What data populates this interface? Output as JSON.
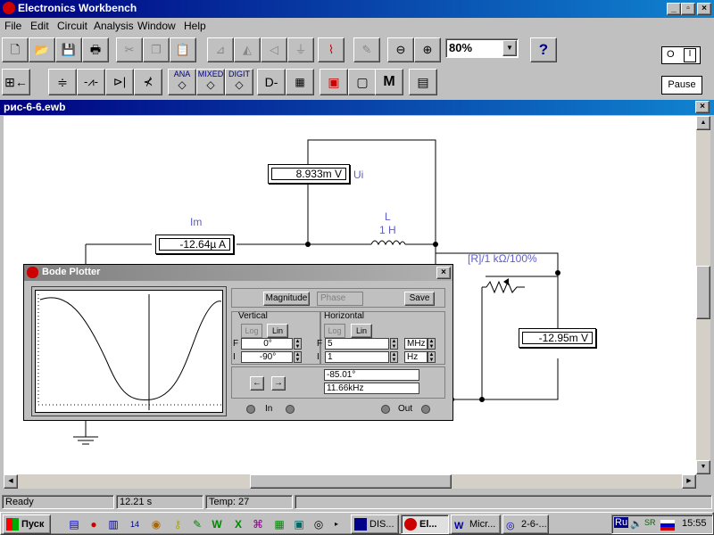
{
  "app": {
    "title": "Electronics Workbench"
  },
  "menu": [
    "File",
    "Edit",
    "Circuit",
    "Analysis",
    "Window",
    "Help"
  ],
  "toolbar": {
    "zoom_value": "80%",
    "help_label": "?",
    "pause_label": "Pause"
  },
  "parts_bin": {
    "analog_label": "ANA",
    "mixed_label": "MIXED",
    "digital_label": "DIGIT",
    "misc_label": "M"
  },
  "document": {
    "title": "рис-6-6.ewb"
  },
  "circuit": {
    "voltmeter_ui": {
      "value": "8.933m V",
      "label": "Ui"
    },
    "ammeter_im": {
      "value": "-12.64µ A",
      "label": "Im"
    },
    "inductor": {
      "label": "L",
      "value": "1 H"
    },
    "potentiometer": {
      "label": "[R]/1 kΩ/100%"
    },
    "voltmeter_out": {
      "value": "-12.95m V"
    }
  },
  "bode_plotter": {
    "title": "Bode Plotter",
    "magnitude_label": "Magnitude",
    "phase_label": "Phase",
    "save_label": "Save",
    "vertical": {
      "label": "Vertical",
      "log": "Log",
      "lin": "Lin",
      "f_label": "F",
      "i_label": "I",
      "f_value": "0°",
      "i_value": "-90°"
    },
    "horizontal": {
      "label": "Horizontal",
      "log": "Log",
      "lin": "Lin",
      "f_label": "F",
      "i_label": "I",
      "f_value": "5",
      "i_value": "1",
      "f_unit": "MHz",
      "i_unit": "Hz"
    },
    "readout": {
      "phase": "-85.01°",
      "freq": "11.66kHz"
    },
    "in_label": "In",
    "out_label": "Out"
  },
  "status": {
    "ready": "Ready",
    "time": "12.21 s",
    "temp": "Temp:  27"
  },
  "taskbar": {
    "start_label": "Пуск",
    "tasks": [
      "DIS...",
      "El...",
      "Micr...",
      "2-6-..."
    ],
    "lang": "Ru",
    "clock": "15:55"
  },
  "colors": {
    "title_bar": "#000080",
    "label_blue": "#5c5ccc",
    "face": "#c0c0c0"
  }
}
